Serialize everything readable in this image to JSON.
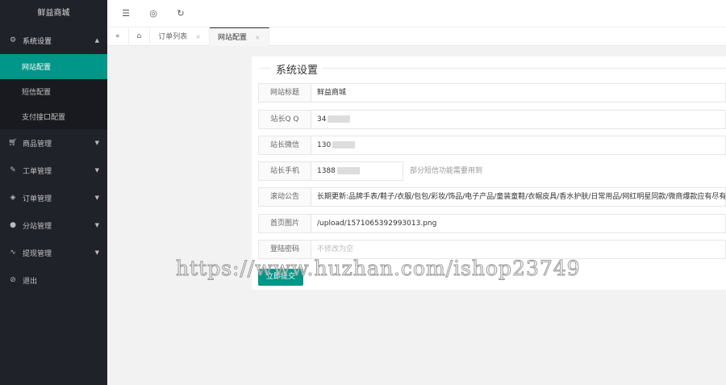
{
  "sidebar": {
    "logo": "鲜益商城",
    "system": "系统设置",
    "sub": [
      "网站配置",
      "短信配置",
      "支付接口配置"
    ],
    "items": [
      "商品管理",
      "工单管理",
      "订单管理",
      "分站管理",
      "提现管理"
    ],
    "logout": "退出"
  },
  "tabs": {
    "t1": "订单列表",
    "t2": "网站配置"
  },
  "form": {
    "title": "系统设置",
    "rows": [
      {
        "label": "网站标题",
        "value": "鲜益商城"
      },
      {
        "label": "站长Q Q",
        "value": "34"
      },
      {
        "label": "站长微信",
        "value": "130"
      },
      {
        "label": "站长手机",
        "value": "1388",
        "hint": "部分短信功能需要用到"
      },
      {
        "label": "滚动公告",
        "value": "长期更新:品牌手表/鞋子/衣服/包包/彩妆/饰品/电子产品/童装童鞋/衣帽皮具/香水护肤/日常用品/网红明星同款/微商爆款应有尽有。"
      },
      {
        "label": "首页图片",
        "value": "/upload/1571065392993013.png"
      },
      {
        "label": "登陆密码",
        "placeholder": "不修改为空"
      }
    ],
    "submit": "立即提交"
  },
  "watermark": "https://www.huzhan.com/ishop23749"
}
